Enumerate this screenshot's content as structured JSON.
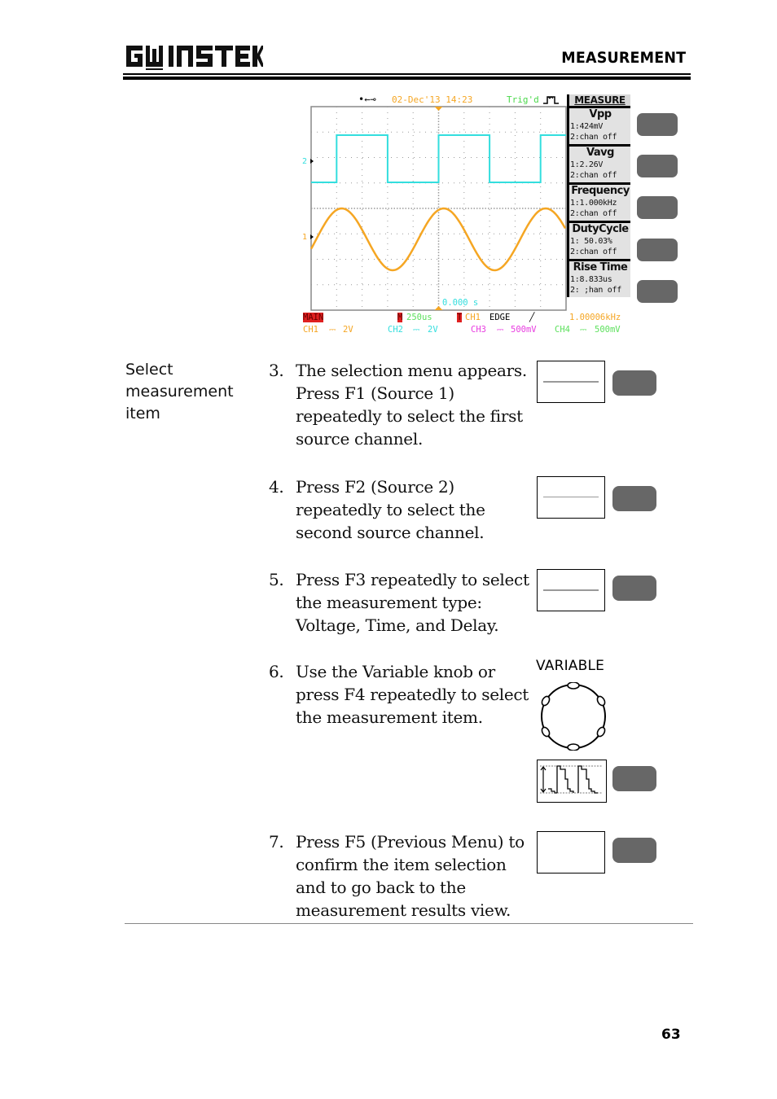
{
  "header": {
    "brand": "GW INSTEK",
    "section_title": "MEASUREMENT"
  },
  "scope": {
    "usb_icon": "usb-icon",
    "datetime": "02-Dec'13 14:23",
    "trigger_status": "Trig'd",
    "time_offset": "0.000 s",
    "channel_markers": [
      "2",
      "1"
    ],
    "menu": {
      "title": "MEASURE",
      "items": [
        {
          "name": "Vpp",
          "line1": "1:424mV",
          "line2": "2:chan off"
        },
        {
          "name": "Vavg",
          "line1": "1:2.26V",
          "line2": "2:chan off"
        },
        {
          "name": "Frequency",
          "line1": "1:1.000kHz",
          "line2": "2:chan off"
        },
        {
          "name": "DutyCycle",
          "line1": "1: 50.03%",
          "line2": "2:chan off"
        },
        {
          "name": "Rise Time",
          "line1": "1:8.833us",
          "line2": "2: ;han off"
        }
      ]
    },
    "status_row1": {
      "mode": "MAIN",
      "timebase_marker": "M",
      "timebase": "250us",
      "trigger_marker": "T",
      "trigger_source": "CH1",
      "trigger_type": "EDGE",
      "trigger_slope": "╱",
      "frequency": "1.00006kHz"
    },
    "status_row2": [
      {
        "label": "CH1",
        "coupling": "⎓",
        "scale": "2V",
        "color": "#f5a623"
      },
      {
        "label": "CH2",
        "coupling": "⎓",
        "scale": "2V",
        "color": "#33dede"
      },
      {
        "label": "CH3",
        "coupling": "⎓",
        "scale": "500mV",
        "color": "#e83ce0"
      },
      {
        "label": "CH4",
        "coupling": "⎓",
        "scale": "500mV",
        "color": "#5de05d"
      }
    ],
    "colors": {
      "ch1": "#f5a623",
      "ch2": "#33dede",
      "grid": "#9a9a9a",
      "trig_status": "#4bd84b",
      "datetime": "#f5a623"
    }
  },
  "left_label": "Select\nmeasurement\nitem",
  "steps": [
    {
      "num": "3.",
      "text": "The selection menu appears.\nPress F1 (Source 1)\nrepeatedly to select the first\nsource channel."
    },
    {
      "num": "4.",
      "text": "Press F2 (Source 2)\nrepeatedly to select the\nsecond source channel."
    },
    {
      "num": "5.",
      "text": "Press F3 repeatedly to select\nthe measurement type:\nVoltage, Time, and Delay."
    },
    {
      "num": "6.",
      "text": "Use the Variable knob or\npress F4 repeatedly to select\nthe measurement item."
    },
    {
      "num": "7.",
      "text": "Press F5 (Previous Menu) to\nconfirm the item selection\nand to go back to the\nmeasurement results view."
    }
  ],
  "variable_label": "VARIABLE",
  "page_number": "63"
}
